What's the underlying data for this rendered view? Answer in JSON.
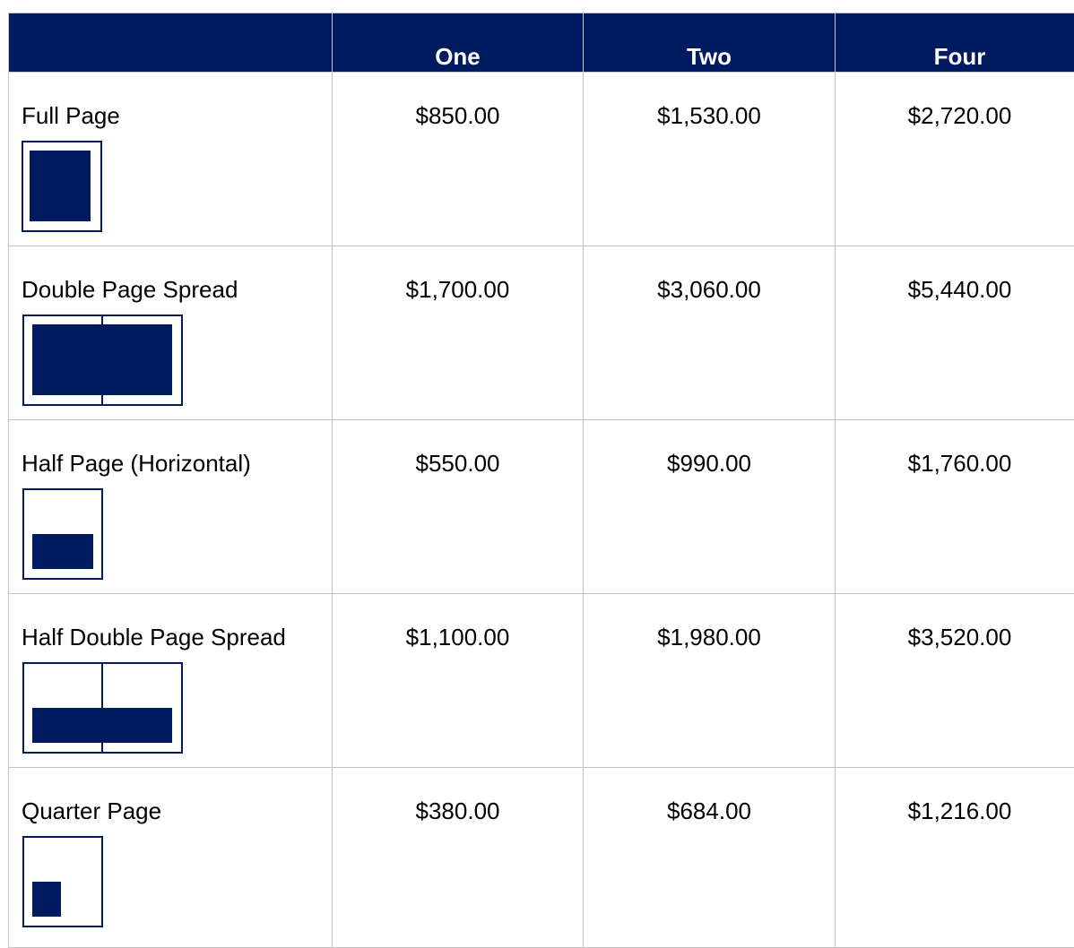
{
  "table": {
    "header": {
      "blank": "",
      "col_one": "One",
      "col_two": "Two",
      "col_four": "Four"
    },
    "rows": [
      {
        "name": "Full Page",
        "one": "$850.00",
        "two": "$1,530.00",
        "four": "$2,720.00",
        "icon": "full-page-icon"
      },
      {
        "name": "Double Page Spread",
        "one": "$1,700.00",
        "two": "$3,060.00",
        "four": "$5,440.00",
        "icon": "double-page-spread-icon"
      },
      {
        "name": "Half Page (Horizontal)",
        "one": "$550.00",
        "two": "$990.00",
        "four": "$1,760.00",
        "icon": "half-page-horizontal-icon"
      },
      {
        "name": "Half Double Page Spread",
        "one": "$1,100.00",
        "two": "$1,980.00",
        "four": "$3,520.00",
        "icon": "half-double-page-spread-icon"
      },
      {
        "name": "Quarter Page",
        "one": "$380.00",
        "two": "$684.00",
        "four": "$1,216.00",
        "icon": "quarter-page-icon"
      }
    ]
  },
  "colors": {
    "header_bg": "#001c5f",
    "icon_fill": "#001c5f",
    "grid_line": "#c2c2c2"
  }
}
